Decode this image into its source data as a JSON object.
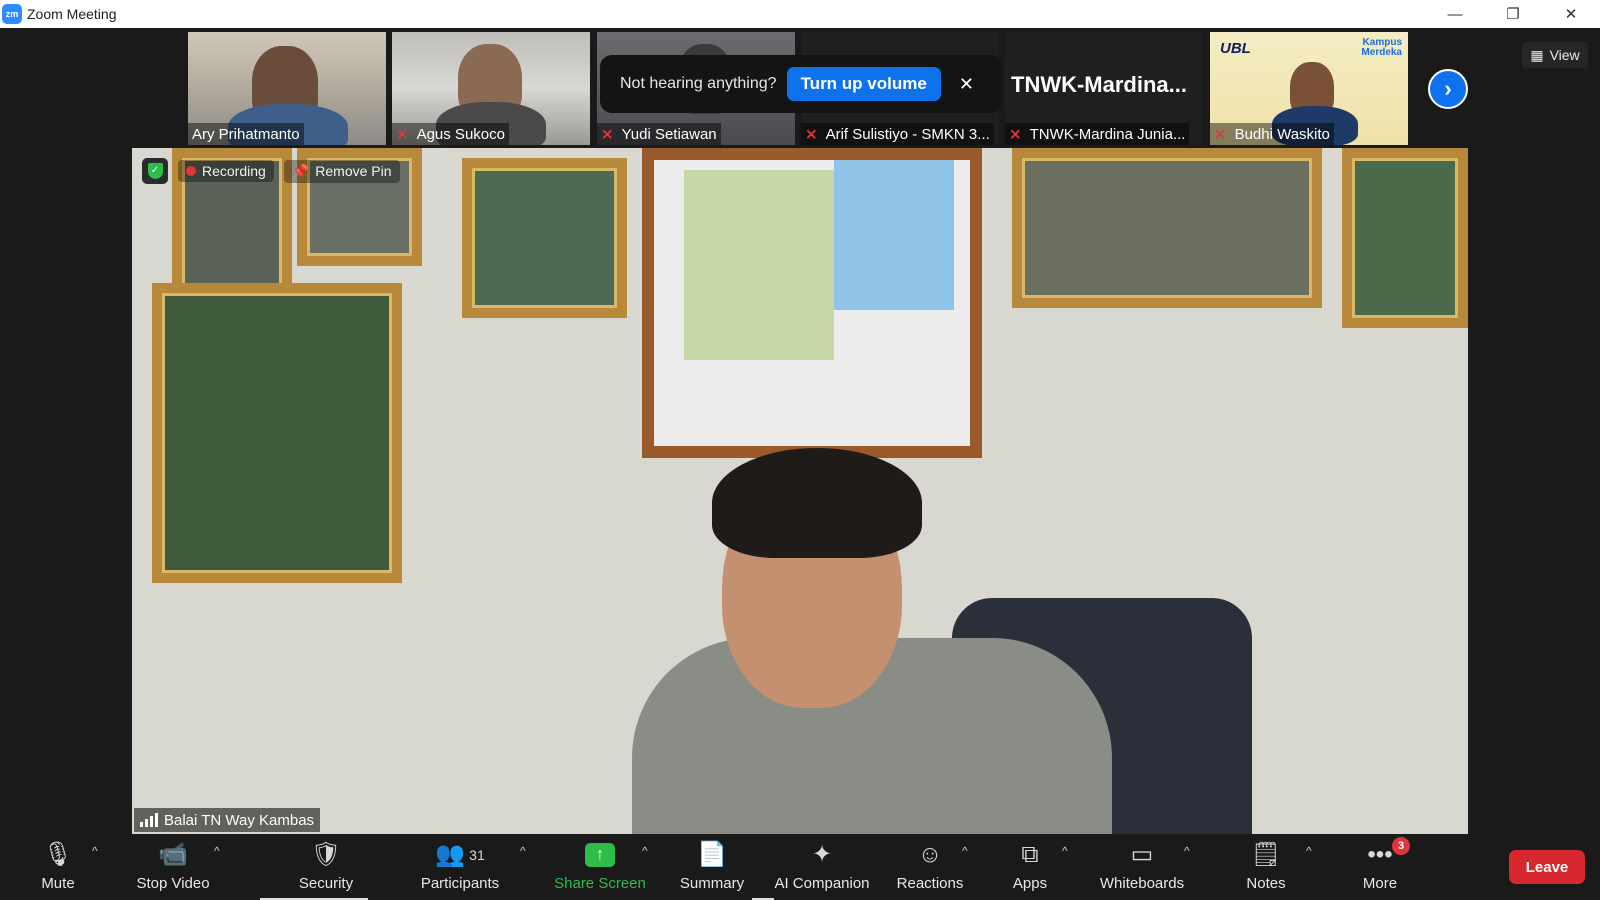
{
  "window": {
    "logo_text": "zm",
    "title": "Zoom Meeting",
    "minimize": "—",
    "restore": "❐",
    "close": "✕"
  },
  "view_button": {
    "label": "View"
  },
  "thumbnails": [
    {
      "name": "Ary Prihatmanto",
      "muted": false
    },
    {
      "name": "Agus Sukoco",
      "muted": true
    },
    {
      "name": "Yudi Setiawan",
      "muted": true
    },
    {
      "name": "Arif Sulistiyo - SMKN 3...",
      "muted": true,
      "display_name": ""
    },
    {
      "name": "TNWK-Mardina Junia...",
      "muted": true,
      "display_name": "TNWK-Mardina..."
    },
    {
      "name": "Budhi Waskito",
      "muted": true
    }
  ],
  "thumb_logos": {
    "ubl": "UBL",
    "kampus_merdeka": "Kampus Merdeka"
  },
  "toast": {
    "message": "Not hearing anything?",
    "button_label": "Turn up volume",
    "close_glyph": "✕"
  },
  "main_video": {
    "recording_label": "Recording",
    "remove_pin_label": "Remove Pin",
    "speaker_name": "Balai TN Way Kambas"
  },
  "toolbar": {
    "mute": "Mute",
    "stop_video": "Stop Video",
    "security": "Security",
    "participants": "Participants",
    "participants_count": "31",
    "share_screen": "Share Screen",
    "summary": "Summary",
    "ai_companion": "AI Companion",
    "reactions": "Reactions",
    "apps": "Apps",
    "whiteboards": "Whiteboards",
    "notes": "Notes",
    "more": "More",
    "more_badge": "3",
    "leave": "Leave"
  },
  "colors": {
    "accent_blue": "#0e72ed",
    "share_green": "#2fbd4a",
    "leave_red": "#d6282e",
    "muted_red": "#e0353a"
  }
}
